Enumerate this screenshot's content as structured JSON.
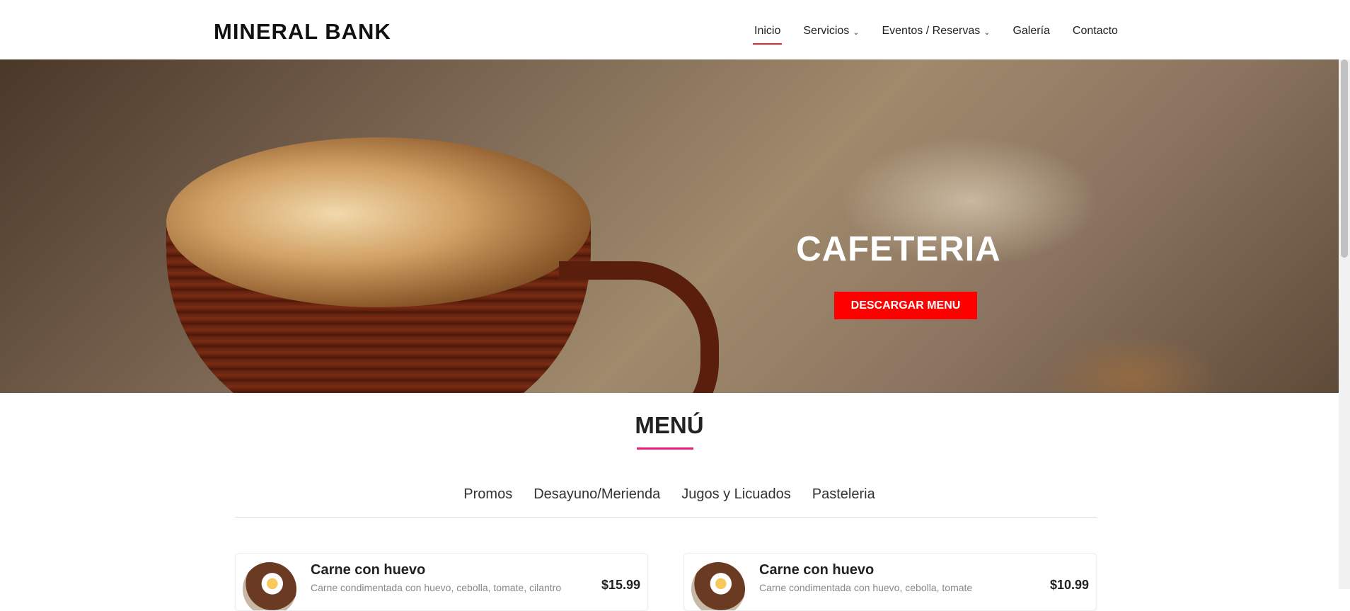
{
  "header": {
    "logo": "MINERAL BANK",
    "nav": [
      {
        "label": "Inicio",
        "active": true,
        "dropdown": false
      },
      {
        "label": "Servicios",
        "active": false,
        "dropdown": true
      },
      {
        "label": "Eventos / Reservas",
        "active": false,
        "dropdown": true
      },
      {
        "label": "Galería",
        "active": false,
        "dropdown": false
      },
      {
        "label": "Contacto",
        "active": false,
        "dropdown": false
      }
    ]
  },
  "hero": {
    "title": "CAFETERIA",
    "button_label": "DESCARGAR MENU",
    "button_color": "#ff0000"
  },
  "menu": {
    "title": "MENÚ",
    "underline_color": "#e91e7a",
    "tabs": [
      "Promos",
      "Desayuno/Merienda",
      "Jugos y Licuados",
      "Pasteleria"
    ],
    "items": [
      {
        "name": "Carne con huevo",
        "description": "Carne condimentada con huevo, cebolla, tomate, cilantro",
        "price": "$15.99"
      },
      {
        "name": "Carne con huevo",
        "description": "Carne condimentada con huevo, cebolla, tomate",
        "price": "$10.99"
      }
    ]
  },
  "icons": {
    "dropdown": "chevron-down-icon"
  }
}
